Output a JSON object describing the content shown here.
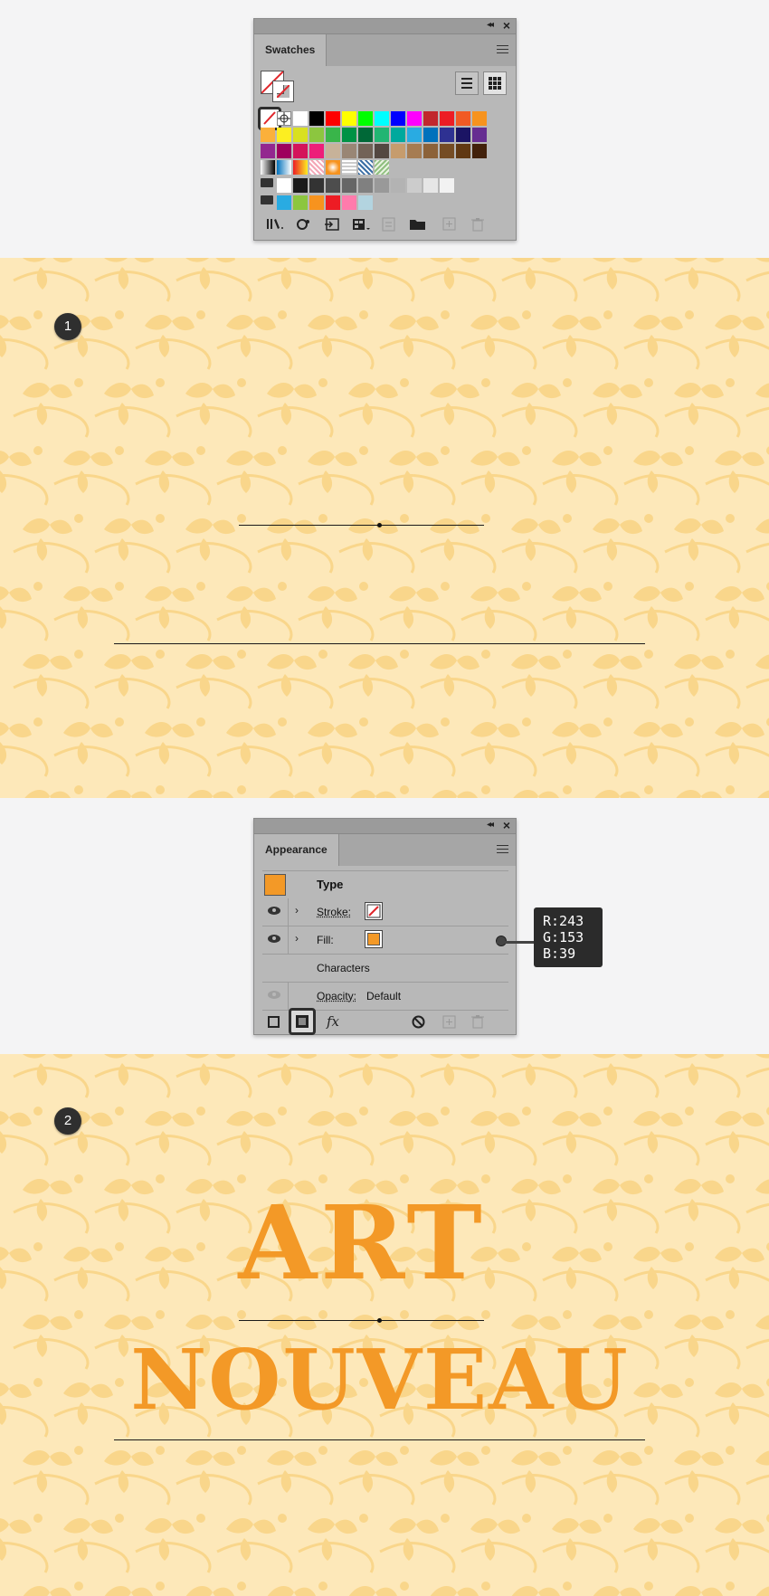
{
  "swatches_panel": {
    "tab_label": "Swatches",
    "rows": [
      [
        "#ffffff",
        "#000000",
        "#ff0000",
        "#ffff00",
        "#00ff00",
        "#00ffff",
        "#0000ff",
        "#ff00ff",
        "#c1272d",
        "#ed1c24",
        "#f15a24",
        "#f7931e"
      ],
      [
        "#fbb03b",
        "#fcee21",
        "#d9e021",
        "#8cc63f",
        "#39b54a",
        "#009245",
        "#006837",
        "#22b573",
        "#00a99d",
        "#29abe2",
        "#0071bc",
        "#2e3192",
        "#1b1464",
        "#662d91"
      ],
      [
        "#93278f",
        "#9e005d",
        "#d4145a",
        "#ed1e79",
        "#c7b299",
        "#998675",
        "#736357",
        "#534741",
        "#c69c6d",
        "#a67c52",
        "#8c6239",
        "#754c24",
        "#603813",
        "#42210b"
      ],
      [
        "#ffffff",
        "#1a1a1a",
        "#333333",
        "#4d4d4d",
        "#666666",
        "#808080",
        "#999999",
        "#b3b3b3",
        "#cccccc",
        "#e6e6e6",
        "#f2f2f2"
      ],
      [
        "#29abe2",
        "#8cc63f",
        "#f7931e",
        "#ed1c24",
        "#ff7bac",
        "#b3d4e0"
      ]
    ]
  },
  "step1": {
    "badge": "1"
  },
  "appearance_panel": {
    "tab_label": "Appearance",
    "rows": {
      "type_label": "Type",
      "stroke_label": "Stroke:",
      "fill_label": "Fill:",
      "characters_label": "Characters",
      "opacity_label": "Opacity:",
      "opacity_value": "Default"
    },
    "fill_color": "#f39927"
  },
  "tooltip": {
    "r": "R:243",
    "g": "G:153",
    "b": "B:39"
  },
  "step2": {
    "badge": "2",
    "line1": "ART",
    "line2": "NOUVEAU"
  },
  "colors": {
    "artboard_bg": "#fde8b9",
    "pattern": "#f9d68b",
    "type_orange": "#f39927"
  }
}
